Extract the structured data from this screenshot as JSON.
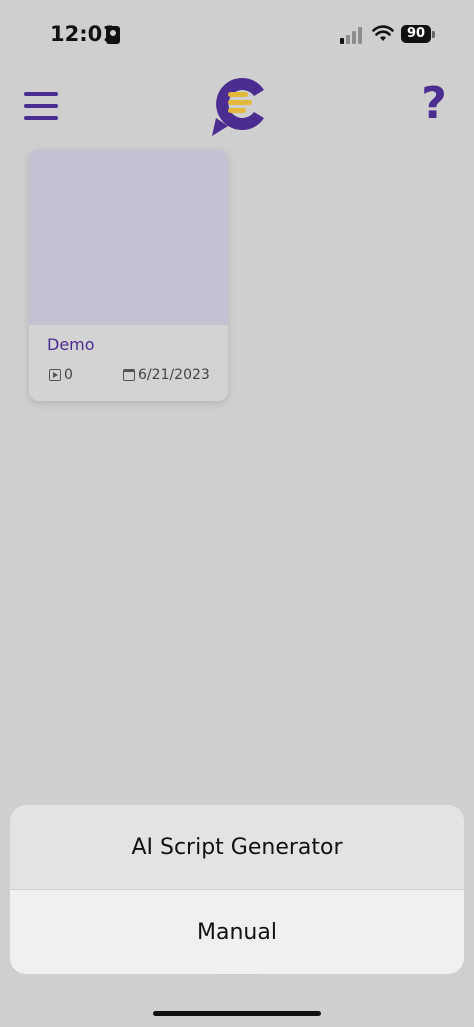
{
  "status_bar": {
    "time": "12:01",
    "battery": "90"
  },
  "header": {
    "help_glyph": "?"
  },
  "project_card": {
    "title": "Demo",
    "clip_count": "0",
    "date": "6/21/2023"
  },
  "action_sheet": {
    "options": [
      {
        "label": "AI Script Generator"
      },
      {
        "label": "Manual"
      }
    ]
  },
  "colors": {
    "brand_purple": "#4b2c91",
    "brand_gold": "#e2b93b",
    "background": "#cfcfcf"
  },
  "icons": {
    "menu": "hamburger-icon",
    "help": "question-mark-icon",
    "clips": "play-icon",
    "date": "calendar-icon"
  }
}
